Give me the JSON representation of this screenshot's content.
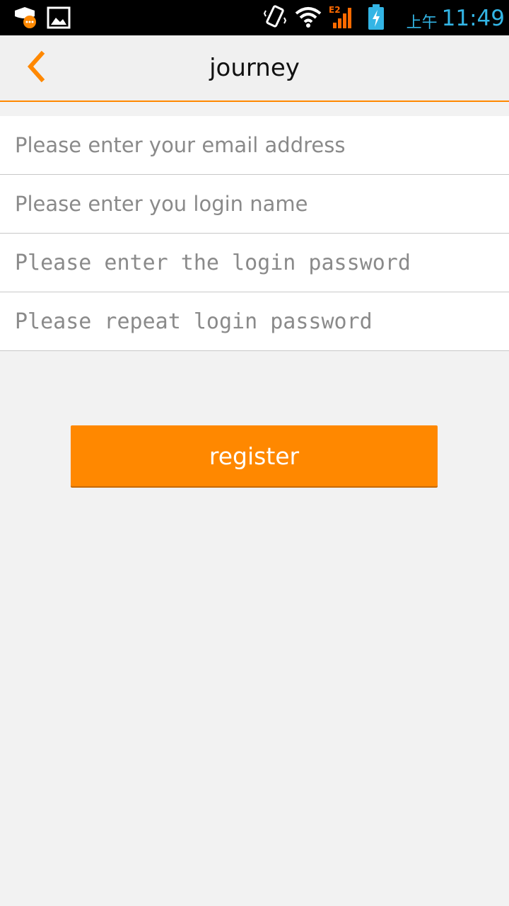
{
  "status_bar": {
    "ampm": "上午",
    "time": "11:49",
    "network": "E2",
    "icons": [
      "notification-app-icon",
      "gallery-icon",
      "vibrate-icon",
      "wifi-icon",
      "signal-icon",
      "battery-charging-icon"
    ]
  },
  "app_bar": {
    "title": "journey",
    "back_icon": "chevron-left-icon"
  },
  "form": {
    "email_placeholder": "Please enter your email address",
    "login_name_placeholder": "Please enter you login name",
    "password_placeholder": "Please enter the login password",
    "repeat_password_placeholder": "Please repeat login password"
  },
  "actions": {
    "register_label": "register"
  },
  "colors": {
    "accent": "#ff8800",
    "status_text": "#33b5e5",
    "background": "#f2f2f2"
  }
}
